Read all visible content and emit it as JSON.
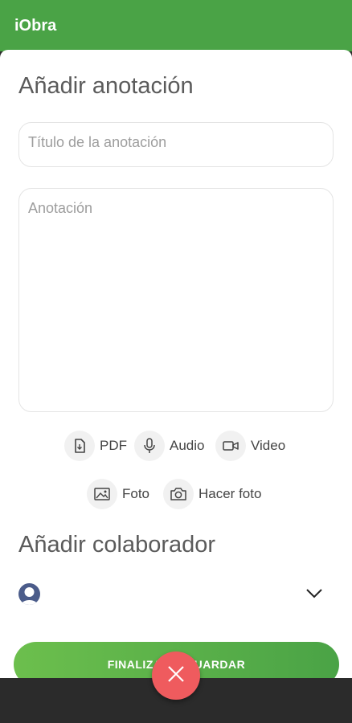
{
  "app": {
    "title": "iObra"
  },
  "annotation_section": {
    "title": "Añadir anotación",
    "title_field": {
      "placeholder": "Título de la anotación",
      "value": ""
    },
    "body_field": {
      "placeholder": "Anotación",
      "value": ""
    }
  },
  "attachments": [
    {
      "label": "PDF",
      "icon": "pdf-file-icon"
    },
    {
      "label": "Audio",
      "icon": "microphone-icon"
    },
    {
      "label": "Video",
      "icon": "video-camera-icon"
    },
    {
      "label": "Foto",
      "icon": "image-icon"
    },
    {
      "label": "Hacer foto",
      "icon": "camera-icon"
    }
  ],
  "collaborator_section": {
    "title": "Añadir colaborador",
    "selected": {
      "avatar_icon": "user-avatar-icon",
      "name": ""
    },
    "dropdown_icon": "chevron-down-icon"
  },
  "save_button": {
    "label": "FINALIZAR Y GUARDAR"
  },
  "fab": {
    "icon": "close-icon"
  },
  "colors": {
    "primary": "#4aa346",
    "fab": "#ef5b5e",
    "avatar": "#4b5c8a"
  }
}
